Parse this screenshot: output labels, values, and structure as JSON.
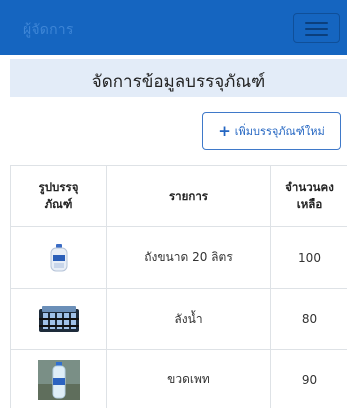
{
  "navbar": {
    "brand": "ผู้จัดการ",
    "toggler_icon": "hamburger-icon"
  },
  "page": {
    "title": "จัดการข้อมูลบรรจุภัณฑ์"
  },
  "actions": {
    "add_label": "เพิ่มบรรจุภัณฑ์ใหม่",
    "add_icon": "plus-icon"
  },
  "table": {
    "headers": [
      "รูปบรรจุ\nภัณฑ์",
      "รายการ",
      "จำนวนคง\nเหลือ"
    ],
    "rows": [
      {
        "image": "water-bottle-image",
        "name": "ถังขนาด 20 ลิตร",
        "qty": "100"
      },
      {
        "image": "water-crate-image",
        "name": "ลังน้ำ",
        "qty": "80"
      },
      {
        "image": "plastic-bottle-image",
        "name": "ขวดเพท",
        "qty": "90"
      }
    ]
  },
  "colors": {
    "navbar": "#1565c0",
    "title_band": "#e3ecf8",
    "accent": "#2466c2"
  }
}
